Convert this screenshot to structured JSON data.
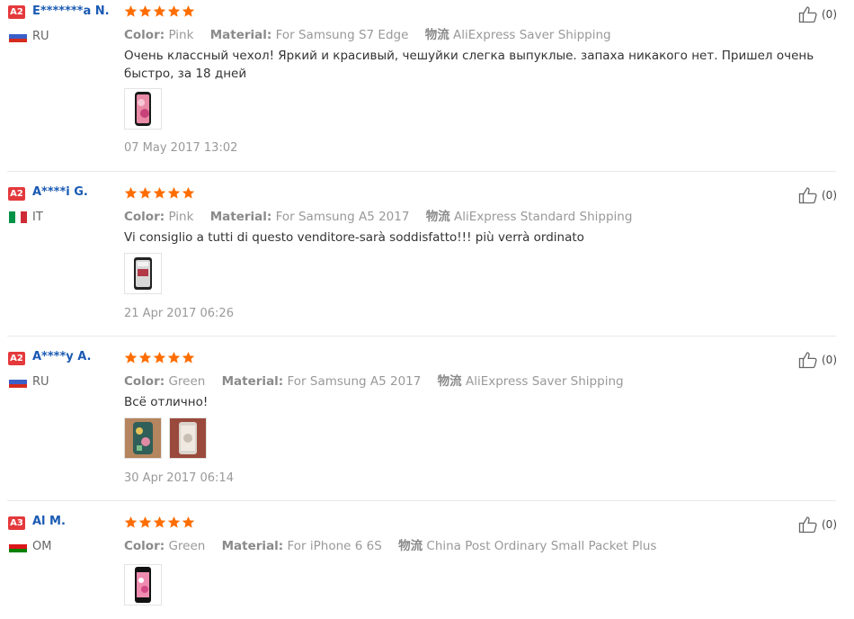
{
  "reviews": [
    {
      "level": "A2",
      "name": "E*******a N.",
      "country": "RU",
      "flag": [
        "#ffffff",
        "#3a5fc8",
        "#d52b1e"
      ],
      "flag_dir": "h",
      "rating": 5,
      "color_label": "Color:",
      "color_value": "Pink",
      "material_label": "Material:",
      "material_value": "For Samsung S7 Edge",
      "shipping_label": "物流",
      "shipping_value": "AliExpress Saver Shipping",
      "text": "Очень классный чехол! Яркий и красивый, чешуйки слегка выпуклые. запаха никакого нет. Пришел очень быстро, за 18 дней",
      "date": "07 May 2017 13:02",
      "likes": "(0)"
    },
    {
      "level": "A2",
      "name": "A****i G.",
      "country": "IT",
      "flag": [
        "#009246",
        "#ffffff",
        "#ce2b37"
      ],
      "flag_dir": "v",
      "rating": 5,
      "color_label": "Color:",
      "color_value": "Pink",
      "material_label": "Material:",
      "material_value": "For Samsung A5 2017",
      "shipping_label": "物流",
      "shipping_value": "AliExpress Standard Shipping",
      "text": "Vi consiglio a tutti di questo venditore-sarà soddisfatto!!! più verrà ordinato",
      "date": "21 Apr 2017 06:26",
      "likes": "(0)"
    },
    {
      "level": "A2",
      "name": "A****y A.",
      "country": "RU",
      "flag": [
        "#ffffff",
        "#3a5fc8",
        "#d52b1e"
      ],
      "flag_dir": "h",
      "rating": 5,
      "color_label": "Color:",
      "color_value": "Green",
      "material_label": "Material:",
      "material_value": "For Samsung A5 2017",
      "shipping_label": "物流",
      "shipping_value": "AliExpress Saver Shipping",
      "text": "Всё отлично!",
      "date": "30 Apr 2017 06:14",
      "likes": "(0)"
    },
    {
      "level": "A3",
      "name": "Al M.",
      "country": "OM",
      "flag": [
        "#ffffff",
        "#db161b",
        "#008000"
      ],
      "flag_dir": "h",
      "rating": 5,
      "color_label": "Color:",
      "color_value": "Green",
      "material_label": "Material:",
      "material_value": "For iPhone 6 6S",
      "shipping_label": "物流",
      "shipping_value": "China Post Ordinary Small Packet Plus",
      "text": "",
      "date": "",
      "likes": "(0)"
    }
  ],
  "colors": {
    "star": "#ff6d00",
    "badge": "#e4393c",
    "name": "#1a5ab3"
  }
}
